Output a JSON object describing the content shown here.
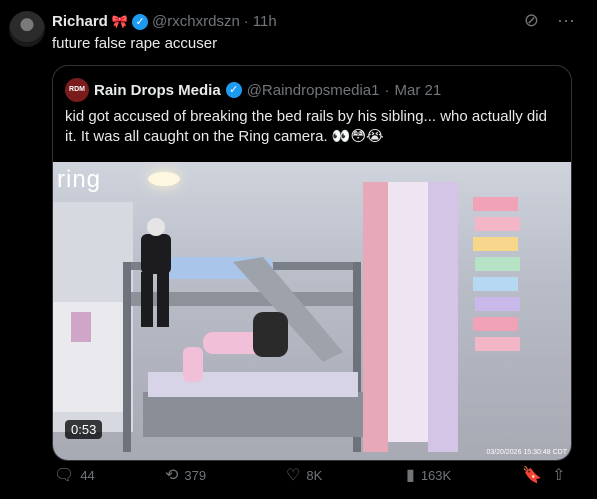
{
  "author": {
    "name": "Richard",
    "handle": "@rxchxrdszn",
    "time": "11h",
    "text": "future false rape accuser"
  },
  "quote": {
    "avatar_label": "RDM",
    "name": "Rain Drops Media",
    "handle": "@Raindropsmedia1",
    "date": "Mar 21",
    "text": "kid got accused of breaking the bed rails by his sibling... who actually did it. It was all caught on the Ring camera. 👀😳😭",
    "video": {
      "overlay_logo": "ring",
      "duration": "0:53",
      "timestamp": "03/20/2026 15:30:48 CDT"
    }
  },
  "stats": {
    "replies": "44",
    "reposts": "379",
    "likes": "8K",
    "views": "163K"
  },
  "icons": {
    "bow": "ribbon-icon",
    "verified": "verified-badge-icon",
    "grok": "grok-icon",
    "more": "more-icon",
    "reply": "reply-icon",
    "repost": "repost-icon",
    "like": "like-icon",
    "views": "views-icon",
    "bookmark": "bookmark-icon",
    "share": "share-icon"
  },
  "colors": {
    "background": "#000000",
    "text": "#e7e9ea",
    "muted": "#71767b",
    "verified": "#1d9bf0",
    "border": "#2f3336"
  }
}
